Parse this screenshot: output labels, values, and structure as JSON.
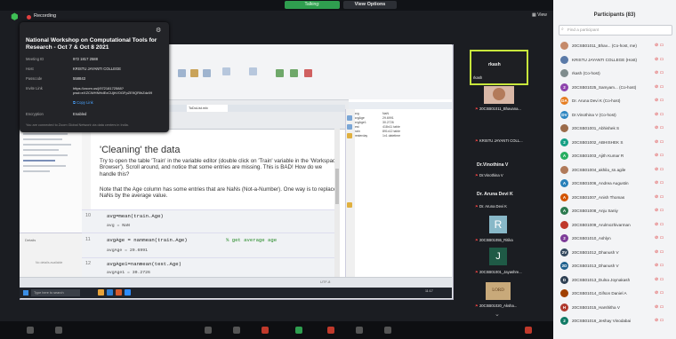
{
  "top": {
    "talking": "Talking:",
    "view_options": "View Options",
    "recording": "Recording",
    "view": "View"
  },
  "meeting_info": {
    "title": "National Workshop on Computational Tools for Research - Oct 7 & Oct 8 2021",
    "rows": [
      {
        "key": "Meeting ID",
        "value": "972 1817 2588"
      },
      {
        "key": "Host",
        "value": "KRISTU JAYANTI COLLEGE"
      },
      {
        "key": "Passcode",
        "value": "558843"
      },
      {
        "key": "Invite Link",
        "value": ""
      },
      {
        "key": "Encryption",
        "value": "Enabled"
      }
    ],
    "invite_link": "https://zoom.us/j/97218172588?pwd=eXZCWHNHdExCUjhVOGFpZE9QRlhZdz09",
    "copy_link": "Copy Link",
    "footer": "You are connected to Zoom Global Network via data centers in India."
  },
  "matlab": {
    "editor_tab": "ToDoList.mlx",
    "section_title": "'Cleaning' the data",
    "para1": "Try to open the table 'Train' in the variable editor (double click on 'Train' variable in the 'Workspace Browser'). Scroll around, and notice that some entries are missing. This is BAD! How do we handle this?",
    "para2": "Note that the Age column has some entries that are NaNs (Not-a-Number). One way is to replace NaNs by the average value.",
    "code_lines": [
      {
        "num": "10",
        "code": "avg=mean(train.Age)",
        "output": "avg = NaN",
        "comment": ""
      },
      {
        "num": "11",
        "code": "avgAge = nanmean(train.Age)",
        "output": "avgAge = 29.6991",
        "comment": "% get average age"
      },
      {
        "num": "12",
        "code": "avgAge1=nanmean(test.Age)",
        "output": "avgAge1 = 30.2726",
        "comment": ""
      }
    ],
    "workspace_rows": [
      {
        "name": "avg",
        "value": "NaN"
      },
      {
        "name": "avgAge",
        "value": "29.6991"
      },
      {
        "name": "avgAge1",
        "value": "30.2726"
      },
      {
        "name": "test",
        "value": "418x11 table"
      },
      {
        "name": "train",
        "value": "891x12 table"
      },
      {
        "name": "yesterday",
        "value": "1x1 datetime"
      }
    ],
    "left_panel_title": "Details",
    "left_panel_sub": "No details available",
    "status": "UTF-8",
    "taskbar_search": "Type here to search",
    "clock": "11:17"
  },
  "video_tiles": [
    {
      "name": "rkash",
      "sub": "rkash"
    },
    {
      "name": "",
      "sub": "20CSB01011_Bhavana..."
    },
    {
      "name": "",
      "sub": "KRISTU JAYANTI COLL..."
    },
    {
      "name": "Dr.Vinothina V",
      "sub": "Dr.Vinothina V"
    },
    {
      "name": "Dr. Aruna Devi K",
      "sub": "Dr. Aruna Devi K"
    },
    {
      "name": "",
      "sub": "20CSB01055_Ritika"
    },
    {
      "name": "",
      "sub": "20CSB01001_Jayashre..."
    },
    {
      "name": "",
      "sub": "20CSB01020_Aksha..."
    }
  ],
  "participants": {
    "title": "Participants (83)",
    "search_placeholder": "Find a participant",
    "list": [
      {
        "initials": "",
        "name": "20CSB01011_Bhav... (Co-host, me)",
        "color": "#c58a6a"
      },
      {
        "initials": "",
        "name": "KRISTU JAYANTI COLLEGE (Host)",
        "color": "#5a7aa8"
      },
      {
        "initials": "",
        "name": "rkash (Co-host)",
        "color": "#7f8c8d"
      },
      {
        "initials": "2",
        "name": "20CSB01025_Samyam... (Co-host)",
        "color": "#8e44ad"
      },
      {
        "initials": "DA",
        "name": "Dr. Aruna Devi K (Co-host)",
        "color": "#e67e22"
      },
      {
        "initials": "DV",
        "name": "Dr.Vinothina V (Co-host)",
        "color": "#2e86c1"
      },
      {
        "initials": "",
        "name": "20CSB01001_Abhishek S",
        "color": "#9b6b4a"
      },
      {
        "initials": "2",
        "name": "20CSB01002_ABHISHEK S",
        "color": "#16a085"
      },
      {
        "initials": "A",
        "name": "20CSB01003_Ajith Kumar R",
        "color": "#27ae60"
      },
      {
        "initials": "",
        "name": "20CSB01004_akhila_sn.agile",
        "color": "#b07a5a"
      },
      {
        "initials": "A",
        "name": "20CSB01006_Andrea Augustin",
        "color": "#2980b9"
      },
      {
        "initials": "A",
        "name": "20CSB01007_Anish Thomas",
        "color": "#d35400"
      },
      {
        "initials": "A",
        "name": "20CSB01008_Anju Saniy",
        "color": "#2c7a4f"
      },
      {
        "initials": "",
        "name": "20CSB01009_Arulmozhivarman",
        "color": "#c0392b"
      },
      {
        "initials": "2",
        "name": "20CSB01010_Ashlyn",
        "color": "#7d3c98"
      },
      {
        "initials": "2V",
        "name": "20CSB01012_Dhanush V",
        "color": "#34495e"
      },
      {
        "initials": "2D",
        "name": "20CSB01013_Dhanush V",
        "color": "#1f618d"
      },
      {
        "initials": "D",
        "name": "20CSB01013_Dulna Joynakash",
        "color": "#2e4053"
      },
      {
        "initials": "",
        "name": "20CSB01014_Gifson Daniel A",
        "color": "#a04000"
      },
      {
        "initials": "H",
        "name": "20CSB01015_Harshitha V",
        "color": "#b03a2e"
      },
      {
        "initials": "2",
        "name": "20CSB01016_Jeshay Vinodabai",
        "color": "#117a65"
      }
    ]
  },
  "colors": {
    "accent": "#c8e63c",
    "talking": "#2f9e4f",
    "muted": "#e24040",
    "link": "#4aa3ff"
  }
}
